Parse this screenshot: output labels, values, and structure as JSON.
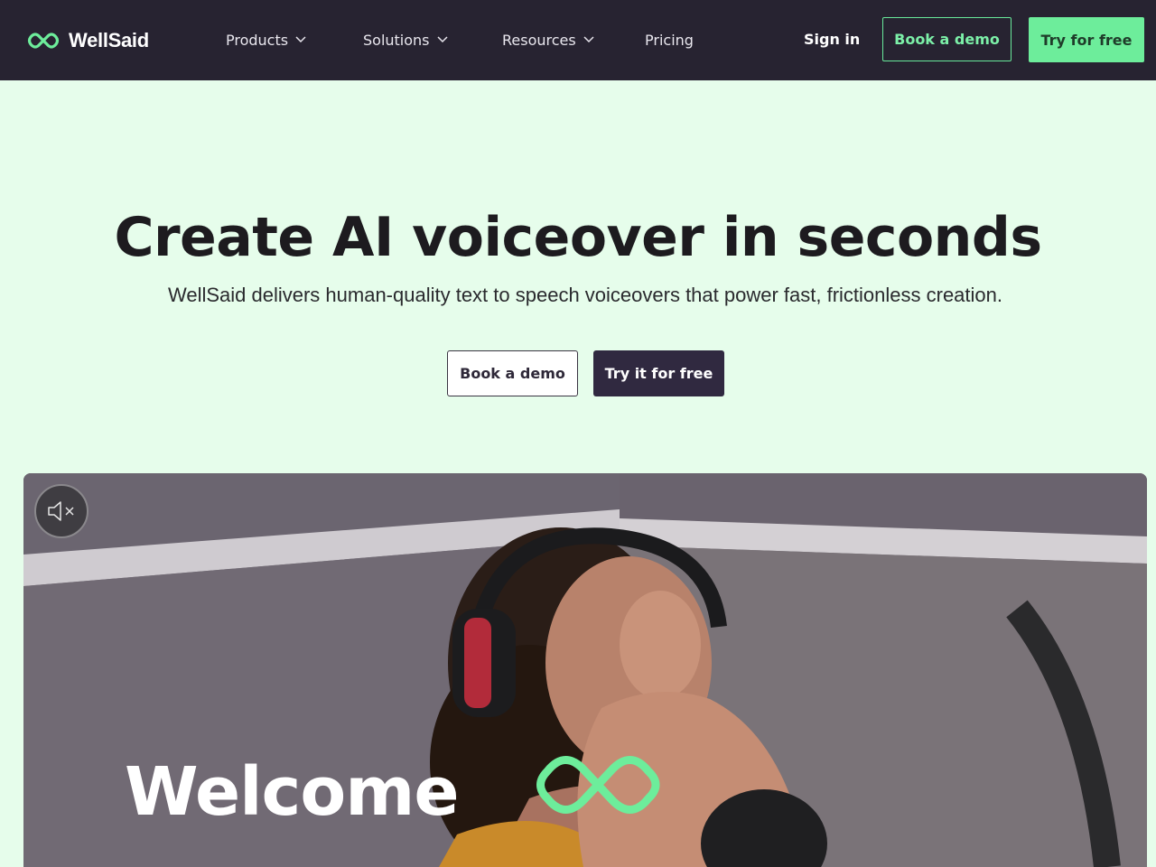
{
  "nav": {
    "brand": "WellSaid",
    "items": [
      {
        "label": "Products",
        "has_dropdown": true
      },
      {
        "label": "Solutions",
        "has_dropdown": true
      },
      {
        "label": "Resources",
        "has_dropdown": true
      },
      {
        "label": "Pricing",
        "has_dropdown": false
      }
    ],
    "sign_in": "Sign in",
    "book_demo": "Book a demo",
    "try_free": "Try for free"
  },
  "hero": {
    "title": "Create AI voiceover in seconds",
    "subtitle": "WellSaid delivers human-quality text to speech voiceovers that power fast, frictionless creation.",
    "book_demo": "Book a demo",
    "try_free": "Try it for free"
  },
  "video": {
    "overlay_text": "Welcome",
    "muted": true
  },
  "colors": {
    "nav_bg": "#272331",
    "page_bg": "#e6fdeb",
    "accent_green": "#6ded9b",
    "dark_button": "#302940"
  },
  "icons": [
    "wellsaid-logo-icon",
    "chevron-down-icon",
    "speaker-muted-icon"
  ]
}
